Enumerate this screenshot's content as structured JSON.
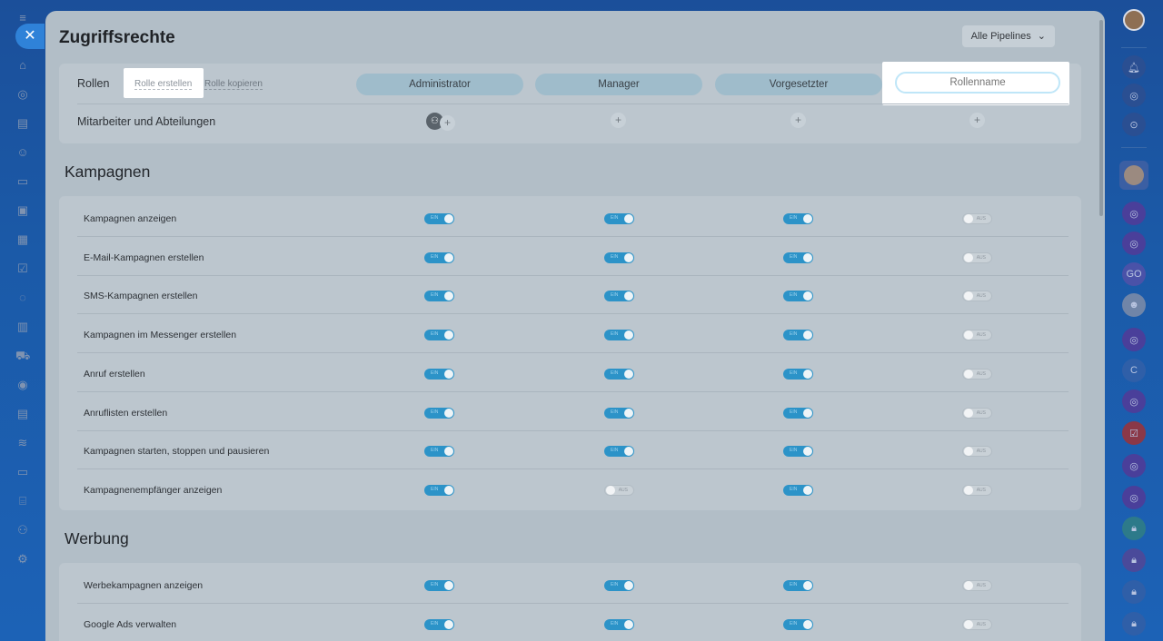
{
  "page_title": "Zugriffsrechte",
  "pipelines_button": "Alle Pipelines",
  "roles": {
    "label": "Rollen",
    "create_label": "Rolle erstellen",
    "copy_label": "Rolle kopieren",
    "names": [
      "Administrator",
      "Manager",
      "Vorgesetzter"
    ],
    "new_role_placeholder": "Rollenname"
  },
  "staff_label": "Mitarbeiter und Abteilungen",
  "toggle_on_text": "EIN",
  "toggle_off_text": "AUS",
  "sections": [
    {
      "title": "Kampagnen",
      "rows": [
        {
          "label": "Kampagnen anzeigen",
          "values": [
            true,
            true,
            true,
            false
          ]
        },
        {
          "label": "E-Mail-Kampagnen erstellen",
          "values": [
            true,
            true,
            true,
            false
          ]
        },
        {
          "label": "SMS-Kampagnen erstellen",
          "values": [
            true,
            true,
            true,
            false
          ]
        },
        {
          "label": "Kampagnen im Messenger erstellen",
          "values": [
            true,
            true,
            true,
            false
          ]
        },
        {
          "label": "Anruf erstellen",
          "values": [
            true,
            true,
            true,
            false
          ]
        },
        {
          "label": "Anruflisten erstellen",
          "values": [
            true,
            true,
            true,
            false
          ]
        },
        {
          "label": "Kampagnen starten, stoppen und pausieren",
          "values": [
            true,
            true,
            true,
            false
          ]
        },
        {
          "label": "Kampagnenempfänger anzeigen",
          "values": [
            true,
            false,
            true,
            false
          ]
        }
      ]
    },
    {
      "title": "Werbung",
      "rows": [
        {
          "label": "Werbekampagnen anzeigen",
          "values": [
            true,
            true,
            true,
            false
          ]
        },
        {
          "label": "Google Ads verwalten",
          "values": [
            true,
            true,
            true,
            false
          ]
        }
      ]
    }
  ],
  "left_rail_icons": [
    "menu-icon",
    "home-icon",
    "feed-icon",
    "tasks-icon",
    "contacts-icon",
    "documents-icon",
    "inbox-icon",
    "sites-icon",
    "checklist-icon",
    "chat-icon",
    "analytics-icon",
    "shop-icon",
    "marketing-icon",
    "crm-icon",
    "automation-icon",
    "store-icon",
    "pipeline-icon",
    "team-icon",
    "settings-icon"
  ],
  "right_rail_icons": [
    "notifications-icon",
    "copilot-icon",
    "search-chat-icon",
    "user-avatar-icon",
    "chat-group-icon",
    "chat-group-icon",
    "group-icon",
    "robot-icon",
    "chat-group-icon",
    "contact-icon",
    "chat-group-icon",
    "checklist-chat-icon",
    "chat-group-icon",
    "chat-group-icon",
    "lock-chat-icon",
    "lock-chat-icon",
    "lock-chat-icon",
    "lock-chat-icon"
  ],
  "right_rail_text": {
    "group_initials": "GO",
    "contact_initial": "C"
  },
  "colors": {
    "toggle_on": "#2c93c8",
    "toggle_off": "#c9d1d7",
    "accent": "#2f82d8"
  }
}
